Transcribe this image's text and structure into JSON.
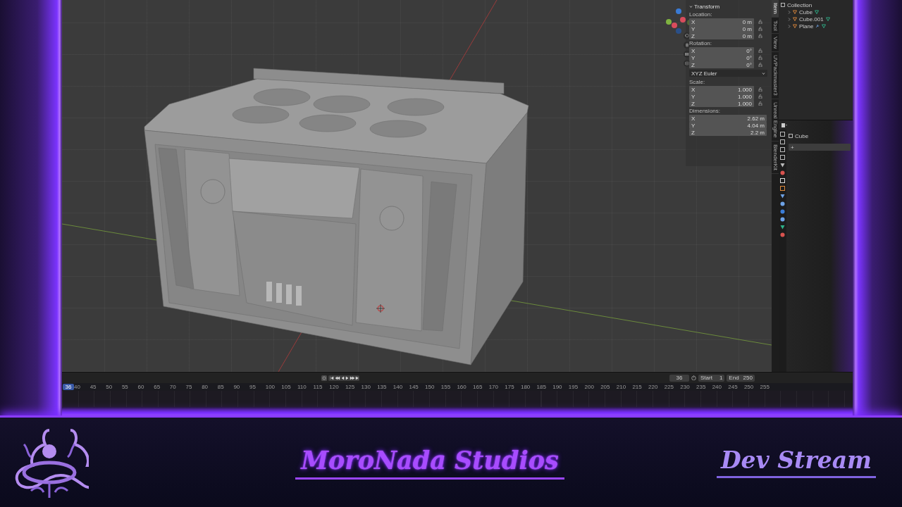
{
  "transform_panel": {
    "title": "Transform",
    "groups": [
      {
        "kind": "fields",
        "label": "Location:",
        "locks": true,
        "fields": [
          {
            "axis": "X",
            "value": "0 m"
          },
          {
            "axis": "Y",
            "value": "0 m"
          },
          {
            "axis": "Z",
            "value": "0 m"
          }
        ]
      },
      {
        "kind": "fields",
        "label": "Rotation:",
        "locks": true,
        "fields": [
          {
            "axis": "X",
            "value": "0°"
          },
          {
            "axis": "Y",
            "value": "0°"
          },
          {
            "axis": "Z",
            "value": "0°"
          }
        ]
      },
      {
        "kind": "dropdown",
        "value": "XYZ Euler"
      },
      {
        "kind": "fields",
        "label": "Scale:",
        "locks": true,
        "fields": [
          {
            "axis": "X",
            "value": "1.000"
          },
          {
            "axis": "Y",
            "value": "1.000"
          },
          {
            "axis": "Z",
            "value": "1.000"
          }
        ]
      },
      {
        "kind": "fields",
        "label": "Dimensions:",
        "locks": false,
        "fields": [
          {
            "axis": "X",
            "value": "2.62 m"
          },
          {
            "axis": "Y",
            "value": "4.04 m"
          },
          {
            "axis": "Z",
            "value": "2.2 m"
          }
        ]
      }
    ]
  },
  "sidebar_tabs": [
    {
      "label": "Item",
      "selected": true
    },
    {
      "label": "Tool",
      "selected": false
    },
    {
      "label": "View",
      "selected": false
    },
    {
      "label": "UVPackmaster3",
      "selected": false
    },
    {
      "label": "Unreal Engine",
      "selected": false
    },
    {
      "label": "BlenderKit",
      "selected": false
    }
  ],
  "outliner": {
    "collection": "Collection",
    "items": [
      {
        "name": "Cube",
        "modifier": false
      },
      {
        "name": "Cube.001",
        "modifier": false
      },
      {
        "name": "Plane",
        "modifier": true
      }
    ]
  },
  "properties": {
    "object_name": "Cube",
    "add_button": "+"
  },
  "timeline": {
    "current_frame": "36",
    "start_label": "Start",
    "start": "1",
    "end_label": "End",
    "end": "250",
    "ruler": [
      {
        "label": "36",
        "selected": true
      },
      {
        "label": "40",
        "selected": false
      },
      {
        "label": "45",
        "selected": false
      },
      {
        "label": "50",
        "selected": false
      },
      {
        "label": "55",
        "selected": false
      },
      {
        "label": "60",
        "selected": false
      },
      {
        "label": "65",
        "selected": false
      },
      {
        "label": "70",
        "selected": false
      },
      {
        "label": "75",
        "selected": false
      },
      {
        "label": "80",
        "selected": false
      },
      {
        "label": "85",
        "selected": false
      },
      {
        "label": "90",
        "selected": false
      },
      {
        "label": "95",
        "selected": false
      },
      {
        "label": "100",
        "selected": false
      },
      {
        "label": "105",
        "selected": false
      },
      {
        "label": "110",
        "selected": false
      },
      {
        "label": "115",
        "selected": false
      },
      {
        "label": "120",
        "selected": false
      },
      {
        "label": "125",
        "selected": false
      },
      {
        "label": "130",
        "selected": false
      },
      {
        "label": "135",
        "selected": false
      },
      {
        "label": "140",
        "selected": false
      },
      {
        "label": "145",
        "selected": false
      },
      {
        "label": "150",
        "selected": false
      },
      {
        "label": "155",
        "selected": false
      },
      {
        "label": "160",
        "selected": false
      },
      {
        "label": "165",
        "selected": false
      },
      {
        "label": "170",
        "selected": false
      },
      {
        "label": "175",
        "selected": false
      },
      {
        "label": "180",
        "selected": false
      },
      {
        "label": "185",
        "selected": false
      },
      {
        "label": "190",
        "selected": false
      },
      {
        "label": "195",
        "selected": false
      },
      {
        "label": "200",
        "selected": false
      },
      {
        "label": "205",
        "selected": false
      },
      {
        "label": "210",
        "selected": false
      },
      {
        "label": "215",
        "selected": false
      },
      {
        "label": "220",
        "selected": false
      },
      {
        "label": "225",
        "selected": false
      },
      {
        "label": "230",
        "selected": false
      },
      {
        "label": "235",
        "selected": false
      },
      {
        "label": "240",
        "selected": false
      },
      {
        "label": "245",
        "selected": false
      },
      {
        "label": "250",
        "selected": false
      },
      {
        "label": "255",
        "selected": false
      }
    ]
  },
  "banner": {
    "title": "MoroNada Studios",
    "subtitle": "Dev Stream"
  }
}
